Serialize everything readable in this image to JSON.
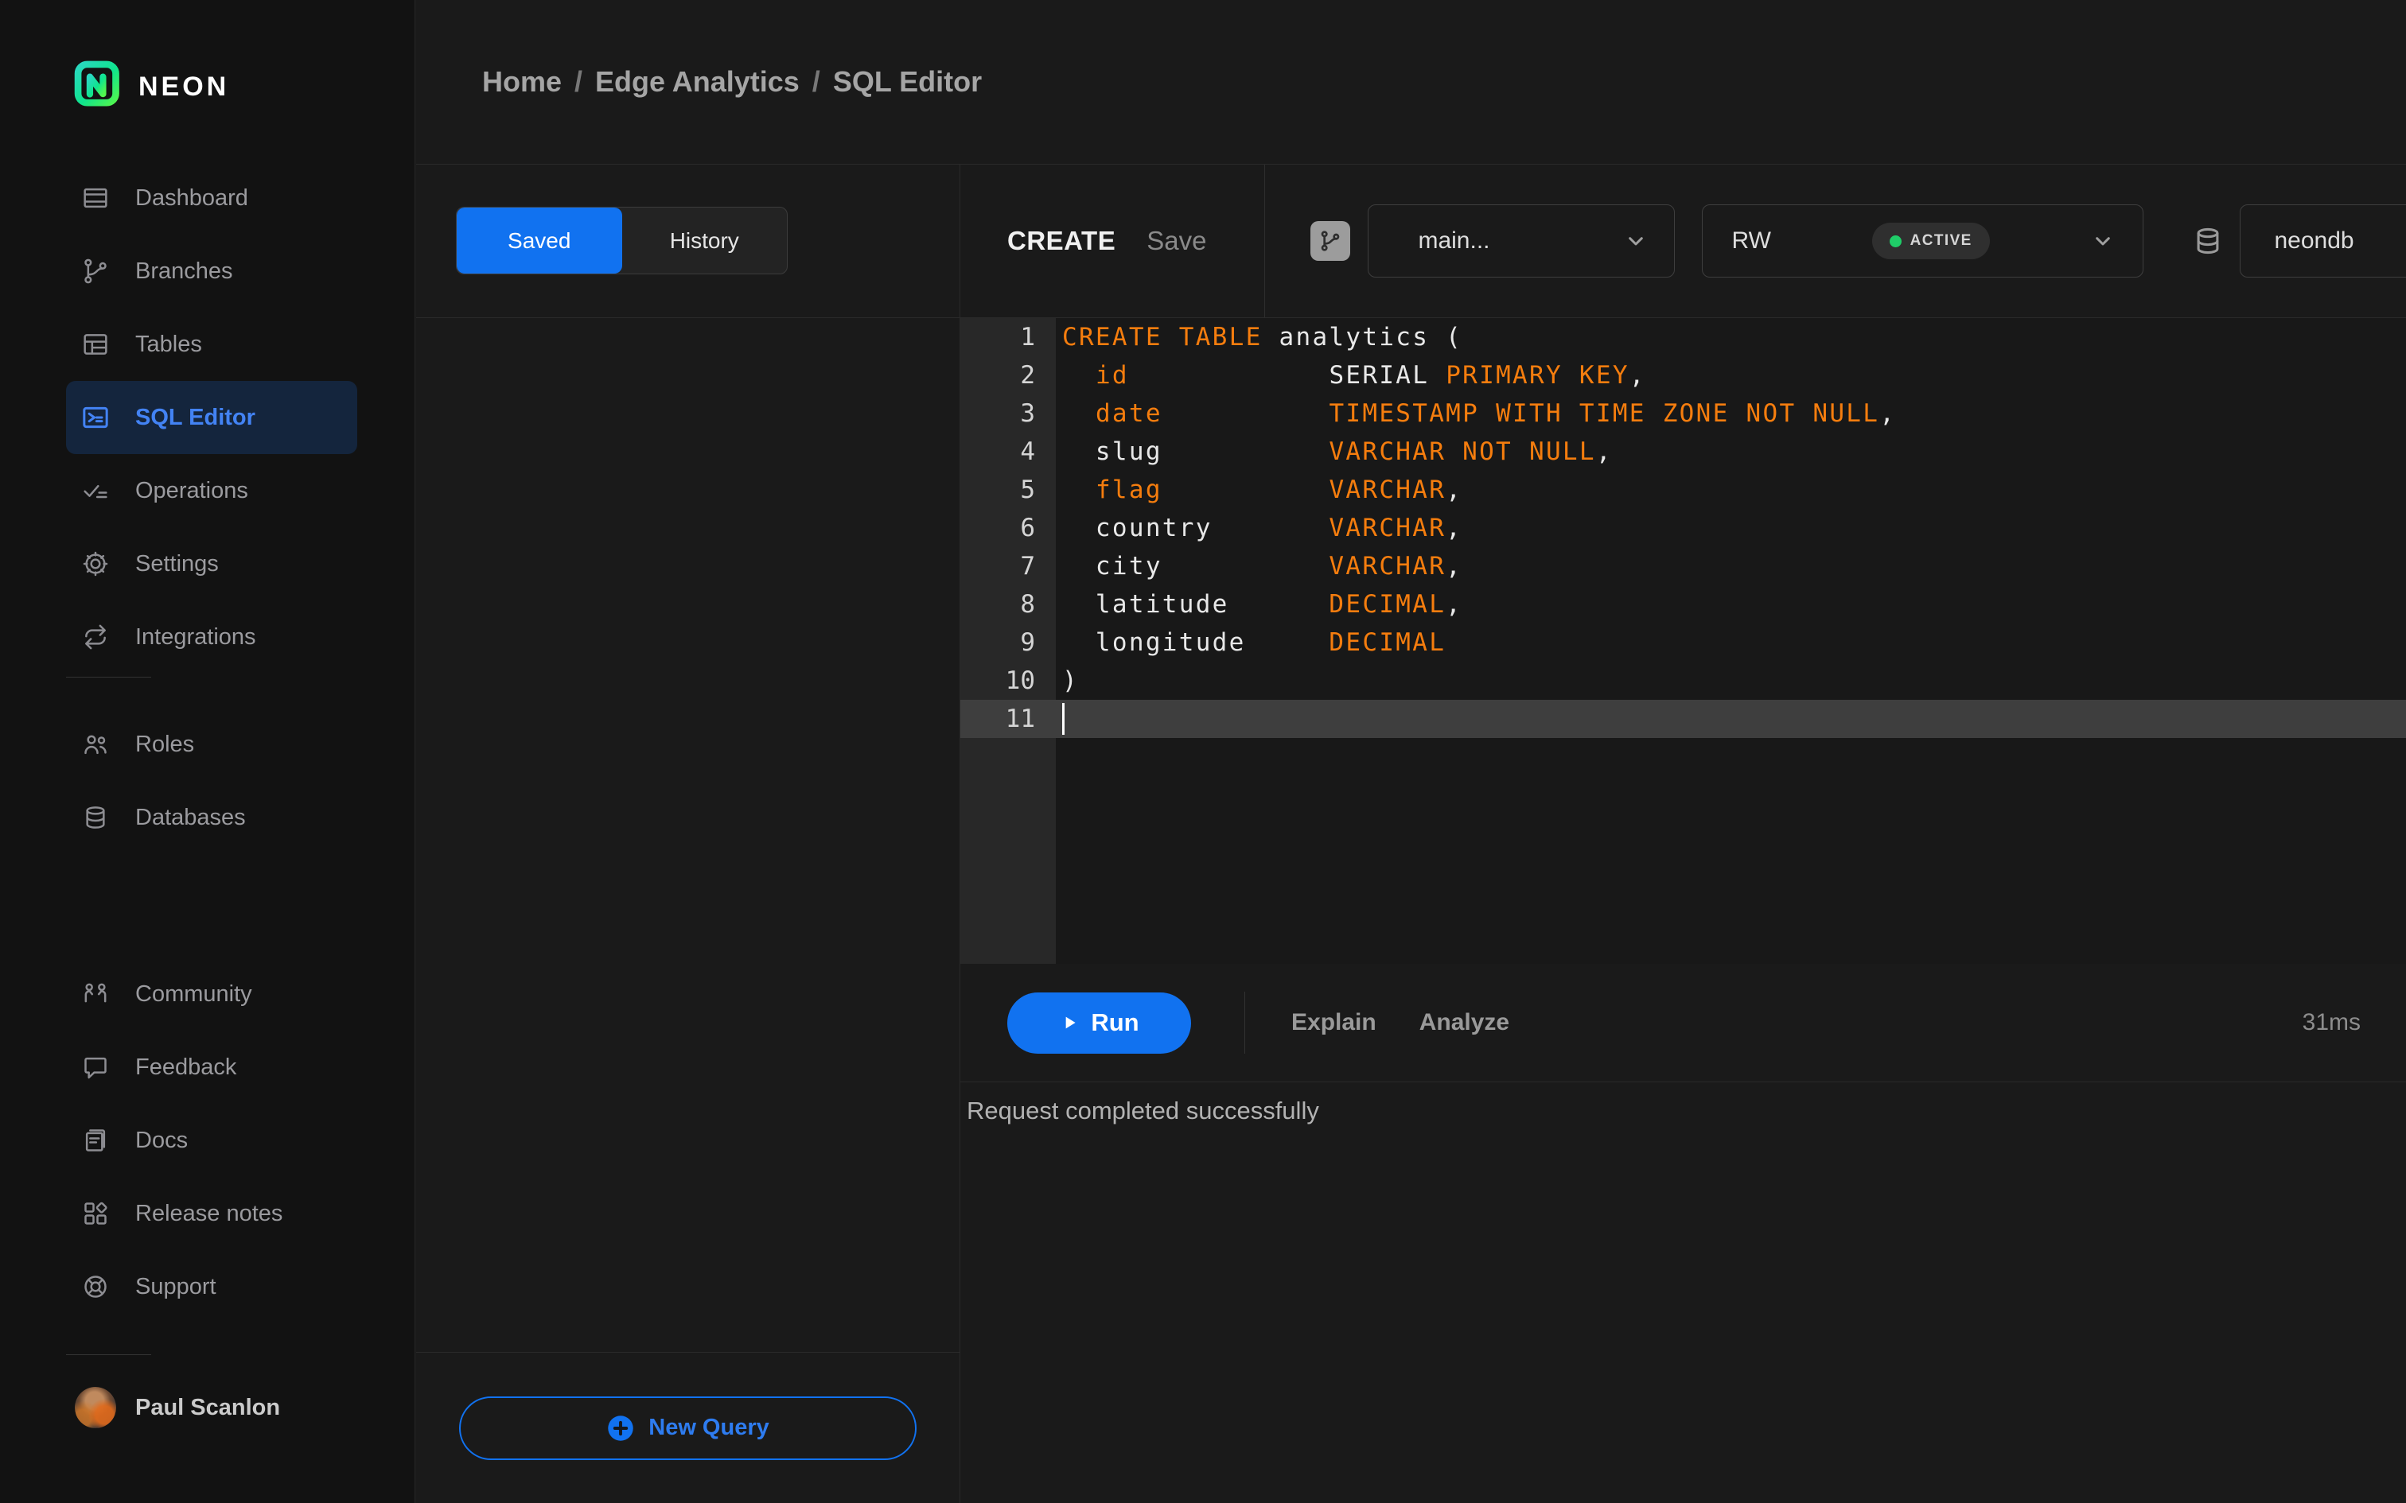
{
  "app": {
    "brand": "NEON"
  },
  "breadcrumb": {
    "items": [
      "Home",
      "Edge Analytics",
      "SQL Editor"
    ],
    "separator": "/"
  },
  "sidebar": {
    "groups": [
      {
        "items": [
          {
            "icon": "dashboard",
            "label": "Dashboard"
          },
          {
            "icon": "branches",
            "label": "Branches"
          },
          {
            "icon": "tables",
            "label": "Tables"
          },
          {
            "icon": "sql-editor",
            "label": "SQL Editor",
            "active": true
          },
          {
            "icon": "operations",
            "label": "Operations"
          },
          {
            "icon": "settings",
            "label": "Settings"
          },
          {
            "icon": "integrations",
            "label": "Integrations"
          }
        ]
      },
      {
        "items": [
          {
            "icon": "roles",
            "label": "Roles"
          },
          {
            "icon": "databases",
            "label": "Databases"
          }
        ]
      },
      {
        "items": [
          {
            "icon": "community",
            "label": "Community"
          },
          {
            "icon": "feedback",
            "label": "Feedback"
          },
          {
            "icon": "docs",
            "label": "Docs"
          },
          {
            "icon": "release-notes",
            "label": "Release notes"
          },
          {
            "icon": "support",
            "label": "Support"
          }
        ]
      }
    ],
    "user": {
      "name": "Paul Scanlon"
    }
  },
  "queries_panel": {
    "tabs": [
      {
        "label": "Saved",
        "active": true
      },
      {
        "label": "History",
        "active": false
      }
    ],
    "new_query_label": "New Query"
  },
  "editor": {
    "toolbar": {
      "query_name": "CREATE",
      "save_label": "Save",
      "branch_select": {
        "value": "main..."
      },
      "compute_select": {
        "value": "RW",
        "status": "ACTIVE"
      },
      "database_select": {
        "value": "neondb"
      }
    },
    "code": {
      "active_line": 11,
      "lines": [
        [
          [
            "kw",
            "CREATE TABLE"
          ],
          [
            "pl",
            " analytics ("
          ]
        ],
        [
          [
            "pl",
            "  "
          ],
          [
            "kw",
            "id"
          ],
          [
            "pl",
            "            SERIAL "
          ],
          [
            "kw",
            "PRIMARY KEY"
          ],
          [
            "pl",
            ","
          ]
        ],
        [
          [
            "pl",
            "  "
          ],
          [
            "kw",
            "date"
          ],
          [
            "pl",
            "          "
          ],
          [
            "kw",
            "TIMESTAMP WITH TIME ZONE NOT NULL"
          ],
          [
            "pl",
            ","
          ]
        ],
        [
          [
            "pl",
            "  slug          "
          ],
          [
            "kw",
            "VARCHAR NOT NULL"
          ],
          [
            "pl",
            ","
          ]
        ],
        [
          [
            "pl",
            "  "
          ],
          [
            "kw",
            "flag"
          ],
          [
            "pl",
            "          "
          ],
          [
            "kw",
            "VARCHAR"
          ],
          [
            "pl",
            ","
          ]
        ],
        [
          [
            "pl",
            "  country       "
          ],
          [
            "kw",
            "VARCHAR"
          ],
          [
            "pl",
            ","
          ]
        ],
        [
          [
            "pl",
            "  city          "
          ],
          [
            "kw",
            "VARCHAR"
          ],
          [
            "pl",
            ","
          ]
        ],
        [
          [
            "pl",
            "  latitude      "
          ],
          [
            "kw",
            "DECIMAL"
          ],
          [
            "pl",
            ","
          ]
        ],
        [
          [
            "pl",
            "  longitude     "
          ],
          [
            "kw",
            "DECIMAL"
          ]
        ],
        [
          [
            "pl",
            ")"
          ]
        ],
        []
      ]
    },
    "run_bar": {
      "run_label": "Run",
      "explain_label": "Explain",
      "analyze_label": "Analyze",
      "duration": "31ms"
    },
    "result_message": "Request completed successfully"
  },
  "colors": {
    "accent_blue": "#1172f0",
    "sidebar_active_blue": "#4383f4",
    "keyword_orange": "#f57d0e",
    "code_plain": "#e8e8e8",
    "status_green": "#1fcd68",
    "logo_green": "#0fe48d"
  }
}
